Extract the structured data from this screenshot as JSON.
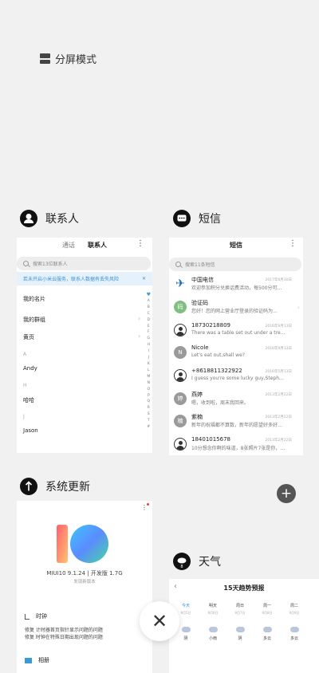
{
  "split_screen": {
    "label": "分屏模式",
    "icon": "split-screen-icon"
  },
  "contacts": {
    "app_title": "联系人",
    "icon": "person-icon",
    "tabs": [
      "通话",
      "联系人"
    ],
    "more": "⋮",
    "search_placeholder": "搜索13位联系人",
    "notice": "若未开启小米云服务，联系人数据有丢失风险",
    "notice_close": "✕",
    "my_card": "我的名片",
    "my_groups": "我的群组",
    "yellow_pages": "黄页",
    "sections": [
      {
        "letter": "A",
        "name": "Andy"
      },
      {
        "letter": "H",
        "name": "哈哈"
      },
      {
        "letter": "J",
        "name": "Jason"
      }
    ],
    "alphabet": [
      "♥",
      "A",
      "B",
      "C",
      "D",
      "E",
      "F",
      "G",
      "H",
      "I",
      "J",
      "K",
      "L",
      "M",
      "N",
      "O",
      "P",
      "Q",
      "R",
      "S",
      "T",
      "#"
    ]
  },
  "sms": {
    "app_title": "短信",
    "icon": "message-icon",
    "title": "短信",
    "more": "⋮",
    "search_placeholder": "搜索11条短信",
    "threads": [
      {
        "name": "中国电信",
        "msg": "欢迎参加积分兑换话费活动，每500分可兑换...",
        "date": "2017年6月30日",
        "avatar": "telecom"
      },
      {
        "name": "验证码",
        "msg": "您好！您的网上营业厅登录的验证码为...",
        "date": "",
        "avatar": "码"
      },
      {
        "name": "18730218809",
        "msg": "There was a table set out under a tree i...",
        "date": "2016年9月13日",
        "avatar": "person"
      },
      {
        "name": "Nicole",
        "msg": "Let's eat out,shall we?",
        "date": "2016年9月13日",
        "avatar": "N"
      },
      {
        "name": "+8618811322922",
        "msg": "I guess you're some lucky guy,Stephan...",
        "date": "2016年5月13日",
        "avatar": "person"
      },
      {
        "name": "燕婷",
        "msg": "嗯，收到啦，周末我回来。",
        "date": "2013年2月22日",
        "avatar": "婷"
      },
      {
        "name": "紫楠",
        "msg": "新年的祝福都不算数，新年的愿望好多好多...",
        "date": "2013年2月22日",
        "avatar": "楠"
      },
      {
        "name": "18401015678",
        "msg": "10分想念你啊的味道，8张照片7张是你，6只...",
        "date": "2013年2月22日",
        "avatar": "person"
      }
    ],
    "fab": "+"
  },
  "updater": {
    "app_title": "系统更新",
    "icon": "arrow-up-icon",
    "more": "⋮",
    "version": "MIUI10 9.1.24 | 开发版 1.7G",
    "sub": "发现新版本",
    "section1": "时钟",
    "lines": [
      "修复 计时器首页指针显示问题的问题",
      "修复 时钟在特殊日期出现问题的问题"
    ],
    "section2": "相册"
  },
  "weather": {
    "app_title": "天气",
    "icon": "weather-icon",
    "back": "‹",
    "title": "15天趋势预报",
    "days": [
      {
        "d": "今天",
        "dt": "9月5日"
      },
      {
        "d": "明天",
        "dt": "9月6日"
      },
      {
        "d": "周日",
        "dt": "9月7日"
      },
      {
        "d": "周一",
        "dt": "9月8日"
      },
      {
        "d": "周二",
        "dt": "9月9日"
      }
    ],
    "conds": [
      "阴",
      "小雨",
      "阴",
      "多云",
      "多云"
    ]
  },
  "close_label": "✕"
}
